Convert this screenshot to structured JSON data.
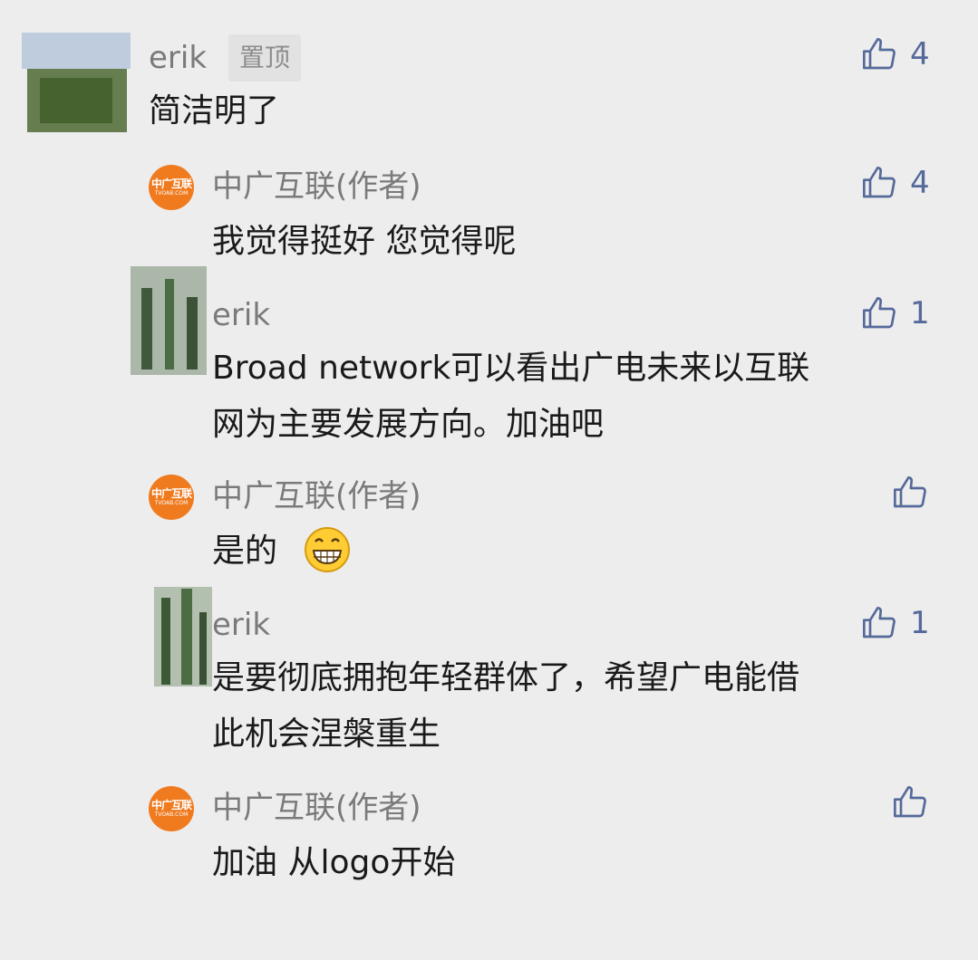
{
  "colors": {
    "background": "#ededed",
    "like": "#55699a",
    "author_avatar": "#f07a1e"
  },
  "comment": {
    "user": "erik",
    "pinned_badge": "置顶",
    "text": "简洁明了",
    "likes": "4"
  },
  "replies": [
    {
      "user": "中广互联(作者)",
      "lines": [
        "我觉得挺好 您觉得呢"
      ],
      "likes": "4",
      "avatar": "author-logo"
    },
    {
      "user": "erik",
      "lines": [
        "Broad network可以看出广电未来以互联",
        "网为主要发展方向。加油吧"
      ],
      "likes": "1",
      "avatar": "photo"
    },
    {
      "user": "中广互联(作者)",
      "lines": [
        "是的"
      ],
      "likes": "",
      "emoji": "grinning-face",
      "avatar": "author-logo"
    },
    {
      "user": "erik",
      "lines": [
        "是要彻底拥抱年轻群体了，希望广电能借",
        "此机会涅槃重生"
      ],
      "likes": "1",
      "avatar": "photo"
    },
    {
      "user": "中广互联(作者)",
      "lines": [
        "加油 从logo开始"
      ],
      "likes": "",
      "avatar": "author-logo"
    }
  ],
  "author_logo": {
    "line1": "中广互联",
    "line2": "TVOAB.COM"
  }
}
